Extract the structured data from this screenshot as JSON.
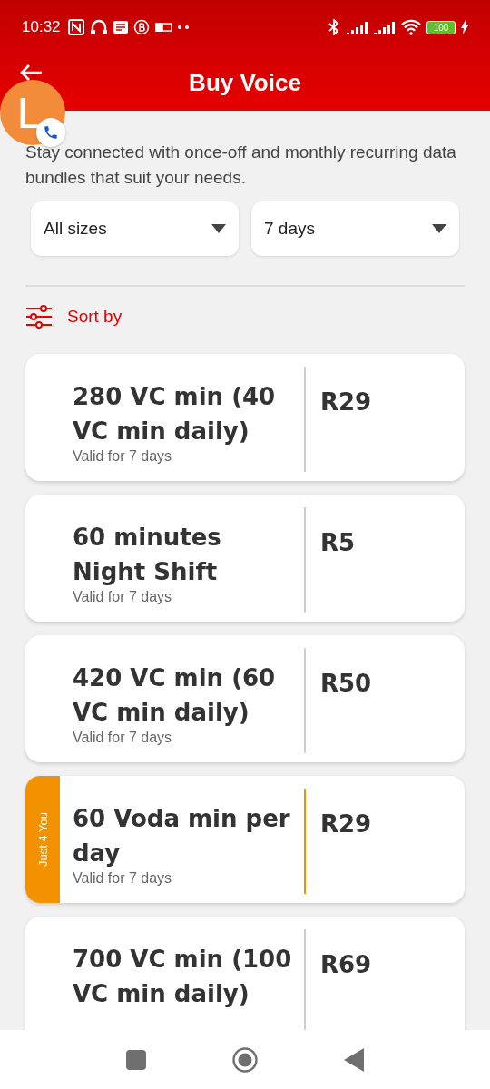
{
  "status_bar": {
    "time": "10:32",
    "battery": "100"
  },
  "header": {
    "title": "Buy Voice"
  },
  "chat_head": {
    "letter": "L"
  },
  "intro": "Stay connected with once-off and monthly recurring data bundles that suit your needs.",
  "filters": [
    {
      "value": "All sizes"
    },
    {
      "value": "7 days"
    }
  ],
  "sort": {
    "label": "Sort by"
  },
  "bundles": [
    {
      "name": "280 VC min (40 VC min daily)",
      "validity": "Valid for 7 days",
      "price": "R29"
    },
    {
      "name": "60 minutes Night Shift",
      "validity": "Valid for 7 days",
      "price": "R5"
    },
    {
      "name": "420 VC min (60 VC min daily)",
      "validity": "Valid for 7 days",
      "price": "R50"
    },
    {
      "name": "60 Voda min per day",
      "validity": "Valid for 7 days",
      "price": "R29",
      "tag": "Just 4 You"
    },
    {
      "name": "700 VC min (100 VC min daily)",
      "price": "R69"
    }
  ]
}
